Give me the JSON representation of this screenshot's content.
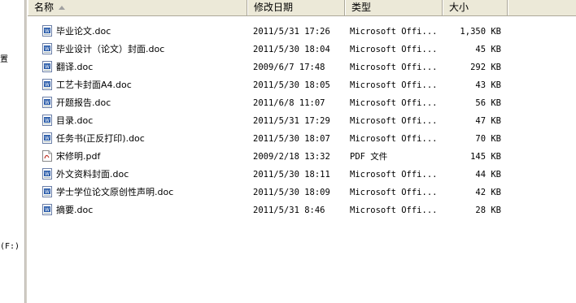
{
  "nav": {
    "fragment_1": "置",
    "fragment_2": "(F:)"
  },
  "columns": {
    "name": "名称",
    "date": "修改日期",
    "type": "类型",
    "size": "大小"
  },
  "files": [
    {
      "name": "毕业论文.doc",
      "date": "2011/5/31 17:26",
      "type": "Microsoft Offi...",
      "size": "1,350 KB",
      "icon": "word-doc-icon"
    },
    {
      "name": "毕业设计（论文）封面.doc",
      "date": "2011/5/30 18:04",
      "type": "Microsoft Offi...",
      "size": "45 KB",
      "icon": "word-doc-icon"
    },
    {
      "name": "翻译.doc",
      "date": "2009/6/7 17:48",
      "type": "Microsoft Offi...",
      "size": "292 KB",
      "icon": "word-doc-icon"
    },
    {
      "name": "工艺卡封面A4.doc",
      "date": "2011/5/30 18:05",
      "type": "Microsoft Offi...",
      "size": "43 KB",
      "icon": "word-doc-icon"
    },
    {
      "name": "开题报告.doc",
      "date": "2011/6/8 11:07",
      "type": "Microsoft Offi...",
      "size": "56 KB",
      "icon": "word-doc-icon"
    },
    {
      "name": "目录.doc",
      "date": "2011/5/31 17:29",
      "type": "Microsoft Offi...",
      "size": "47 KB",
      "icon": "word-doc-icon"
    },
    {
      "name": "任务书(正反打印).doc",
      "date": "2011/5/30 18:07",
      "type": "Microsoft Offi...",
      "size": "70 KB",
      "icon": "word-doc-icon"
    },
    {
      "name": "宋修明.pdf",
      "date": "2009/2/18 13:32",
      "type": "PDF 文件",
      "size": "145 KB",
      "icon": "pdf-icon"
    },
    {
      "name": "外文资料封面.doc",
      "date": "2011/5/30 18:11",
      "type": "Microsoft Offi...",
      "size": "44 KB",
      "icon": "word-doc-icon"
    },
    {
      "name": "学士学位论文原创性声明.doc",
      "date": "2011/5/30 18:09",
      "type": "Microsoft Offi...",
      "size": "42 KB",
      "icon": "word-doc-icon"
    },
    {
      "name": "摘要.doc",
      "date": "2011/5/31 8:46",
      "type": "Microsoft Offi...",
      "size": "28 KB",
      "icon": "word-doc-icon"
    }
  ],
  "colors": {
    "header_bg": "#ece9d8",
    "word_blue": "#2a5caa",
    "pdf_red": "#c0392b"
  }
}
